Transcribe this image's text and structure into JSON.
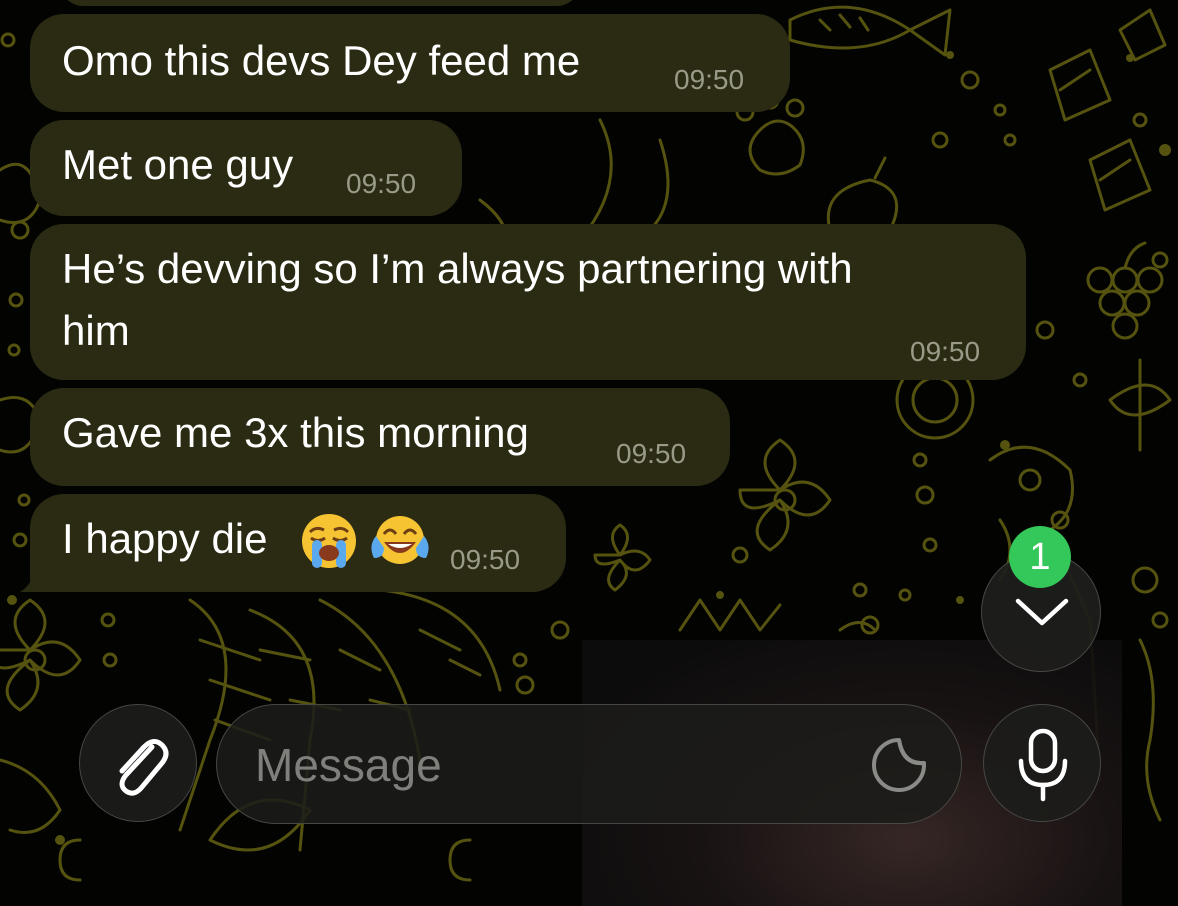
{
  "messages": [
    {
      "text": "Omo this devs Dey feed me",
      "time": "09:50"
    },
    {
      "text": "Met one guy",
      "time": "09:50"
    },
    {
      "text": "He’s devving so I’m always partnering with",
      "text2": "him",
      "time": "09:50"
    },
    {
      "text": "Gave me 3x this morning",
      "time": "09:50"
    },
    {
      "text": "I happy die",
      "time": "09:50"
    }
  ],
  "composer": {
    "placeholder": "Message",
    "attach_icon": "paperclip-icon",
    "sticker_icon": "sticker-icon",
    "mic_icon": "microphone-icon"
  },
  "scroll_down": {
    "icon": "chevron-down-icon",
    "unread_count": "1"
  },
  "colors": {
    "bubble": "#2a2b12",
    "wallpaper_pattern": "#5c5a12",
    "badge": "#34c759"
  }
}
